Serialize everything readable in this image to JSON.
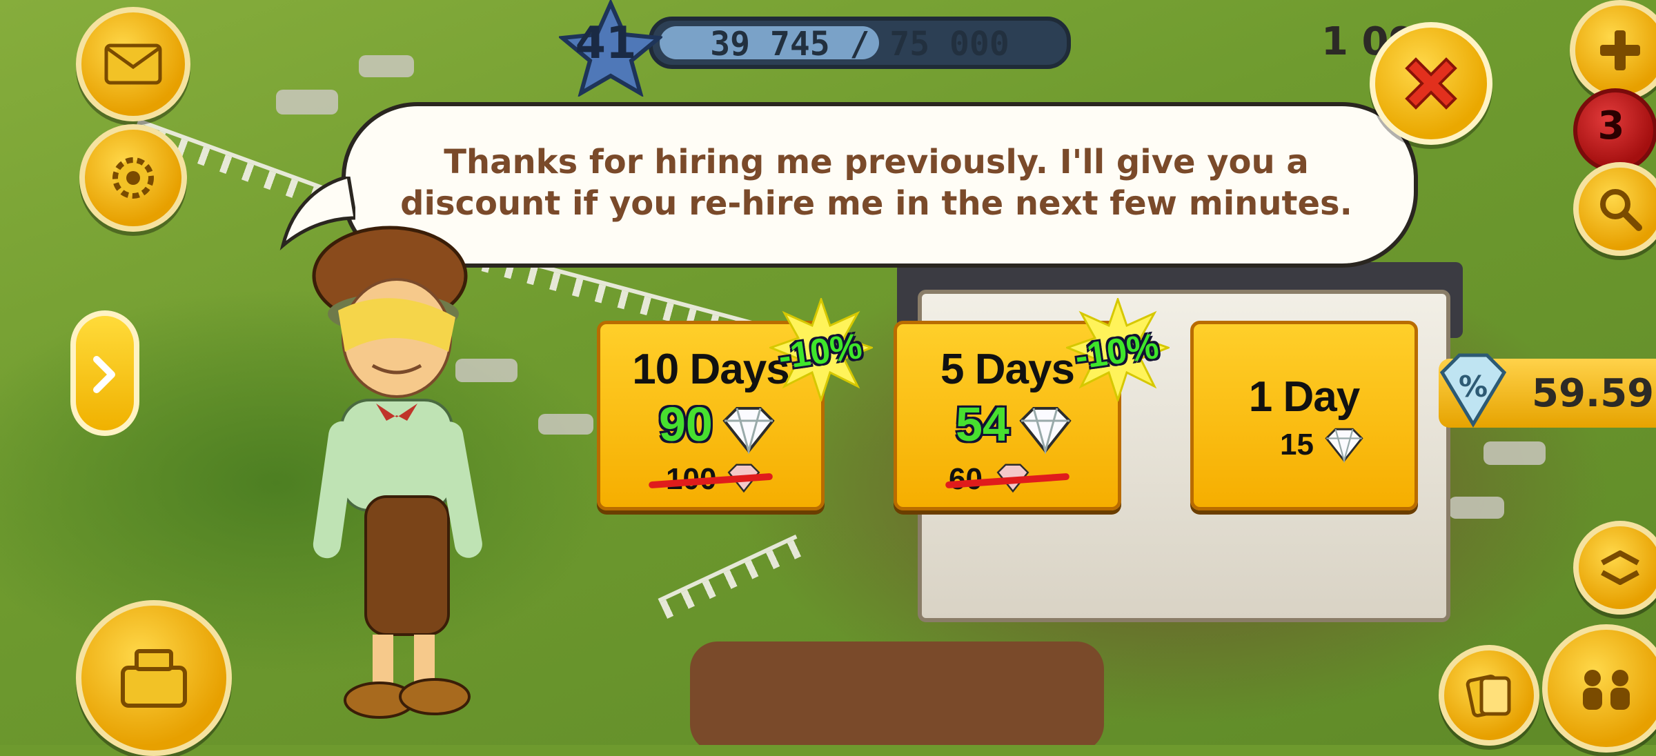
{
  "hud": {
    "level": "41",
    "xp_text": "39 745 / 75 000",
    "xp_progress": 0.53,
    "coins_partial": "1 09",
    "notification_count": "3",
    "discount_value": "59.59"
  },
  "dialog": {
    "message_line1": "Thanks for hiring me previously. I'll give you a",
    "message_line2": "discount if you re-hire me in the next few minutes."
  },
  "offers": [
    {
      "title": "10 Days",
      "price": "90",
      "old_price": "100",
      "discount": "-10%"
    },
    {
      "title": "5 Days",
      "price": "54",
      "old_price": "60",
      "discount": "-10%"
    },
    {
      "title": "1 Day",
      "price": "15"
    }
  ],
  "icons": {
    "mail": "mail-icon",
    "settings": "gear-icon",
    "add": "plus-icon",
    "search": "magnifier-icon",
    "close": "close-icon",
    "arrow": "chevron-right-icon",
    "shop": "cash-register-icon",
    "friends": "friends-icon",
    "cards": "cards-icon",
    "expand": "expand-icon",
    "gem": "diamond-icon"
  },
  "colors": {
    "accent": "#f6ae00",
    "discount_green": "#47e02f",
    "strike_red": "#e01c1c",
    "text_brown": "#7a4a2a"
  }
}
